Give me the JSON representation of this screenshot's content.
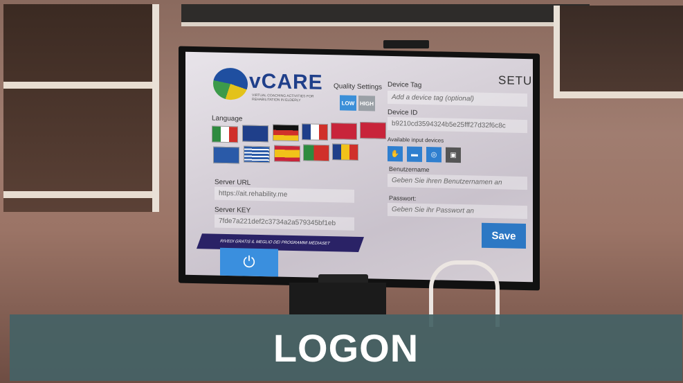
{
  "screen": {
    "app_name": "vCARE",
    "app_subtitle": "VIRTUAL COACHING ACTIVITIES FOR REHABILITATION IN ELDERLY",
    "setup_title": "SETUP",
    "quality_settings_label": "Quality Settings",
    "quality_low": "LOW",
    "quality_high": "HIGH",
    "language_label": "Language",
    "flags": [
      "italy",
      "uk",
      "germany",
      "france",
      "denmark",
      "norway",
      "sweden",
      "greece",
      "spain",
      "portugal",
      "romania"
    ],
    "device_tag_label": "Device Tag",
    "device_tag_placeholder": "Add a device tag (optional)",
    "device_id_label": "Device ID",
    "device_id_value": "b9210cd3594324b5e25fff27d32f6c8c",
    "input_devices_label": "Available input devices",
    "username_label": "Benutzername",
    "username_placeholder": "Geben Sie ihren Benutzernamen an",
    "password_label": "Passwort:",
    "password_placeholder": "Geben Sie ihr Passwort an",
    "server_url_label": "Server URL",
    "server_url_value": "https://ait.rehability.me",
    "server_key_label": "Server KEY",
    "server_key_value": "7fde7a221def2c3734a2a579345bf1eb",
    "save_label": "Save",
    "banner_text": "RIVEDI GRATIS IL MEGLIO DEI PROGRAMMI MEDIASET"
  },
  "caption": {
    "text": "LOGON",
    "color": "#456265"
  }
}
